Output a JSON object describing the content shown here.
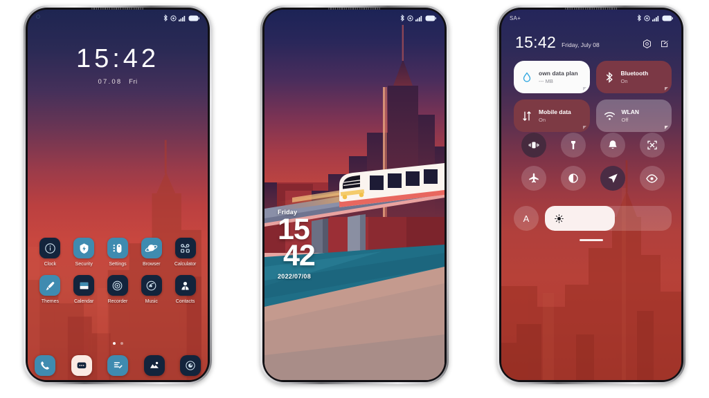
{
  "scene": {
    "background": "#ffffff",
    "phone_count": 3
  },
  "phone1": {
    "name": "home-screen",
    "statusbar": {
      "left_text": "",
      "icons": [
        "bluetooth-icon",
        "alarm-icon",
        "signal-icon",
        "battery-icon"
      ]
    },
    "clock": {
      "time": "15:42",
      "date": "07.08",
      "weekday": "Fri"
    },
    "apps": [
      {
        "label": "Clock",
        "icon": "clock-icon",
        "bg": "#13243c",
        "fg": "#cfe2ef"
      },
      {
        "label": "Security",
        "icon": "shield-icon",
        "bg": "#3f8bb0",
        "fg": "#ffffff"
      },
      {
        "label": "Settings",
        "icon": "settings-icon",
        "bg": "#3f8bb0",
        "fg": "#ffffff"
      },
      {
        "label": "Browser",
        "icon": "browser-icon",
        "bg": "#3f8bb0",
        "fg": "#ffffff"
      },
      {
        "label": "Calculator",
        "icon": "calculator-icon",
        "bg": "#13243c",
        "fg": "#cfe2ef"
      },
      {
        "label": "Themes",
        "icon": "themes-icon",
        "bg": "#3f8bb0",
        "fg": "#ffffff"
      },
      {
        "label": "Calendar",
        "icon": "calendar-icon",
        "bg": "#13243c",
        "fg": "#cfe2ef"
      },
      {
        "label": "Recorder",
        "icon": "recorder-icon",
        "bg": "#13243c",
        "fg": "#cfe2ef"
      },
      {
        "label": "Music",
        "icon": "music-icon",
        "bg": "#13243c",
        "fg": "#cfe2ef"
      },
      {
        "label": "Contacts",
        "icon": "contacts-icon",
        "bg": "#13243c",
        "fg": "#cfe2ef"
      }
    ],
    "page_dots": {
      "count": 2,
      "active_index": 0
    },
    "dock": [
      {
        "label": "Phone",
        "icon": "phone-icon",
        "bg": "#3f8bb0",
        "fg": "#ffffff"
      },
      {
        "label": "Messages",
        "icon": "message-icon",
        "bg": "#fbeae3",
        "fg": "#13243c"
      },
      {
        "label": "Notes",
        "icon": "notes-icon",
        "bg": "#3f8bb0",
        "fg": "#ffffff"
      },
      {
        "label": "Gallery",
        "icon": "gallery-icon",
        "bg": "#13243c",
        "fg": "#ffffff"
      },
      {
        "label": "Camera",
        "icon": "camera-icon",
        "bg": "#13243c",
        "fg": "#cfe2ef"
      }
    ]
  },
  "phone2": {
    "name": "lock-screen",
    "statusbar": {
      "left_text": "",
      "icons": [
        "bluetooth-icon",
        "alarm-icon",
        "signal-icon",
        "battery-icon"
      ]
    },
    "lock": {
      "weekday": "Friday",
      "hour": "15",
      "minute": "42",
      "date": "2022/07/08"
    },
    "wallpaper": {
      "name": "city-train-wallpaper",
      "subject": "elevated train at dusk over river"
    }
  },
  "phone3": {
    "name": "notification-shade",
    "statusbar": {
      "left_text": "SA+",
      "icons": [
        "bluetooth-icon",
        "alarm-icon",
        "signal-icon",
        "battery-icon"
      ]
    },
    "header": {
      "time": "15:42",
      "date": "Friday, July 08",
      "actions": [
        "settings-icon",
        "edit-icon"
      ]
    },
    "big_tiles": [
      {
        "title": "own data plan",
        "subtitle": "--- MB",
        "icon": "data-drop-icon",
        "state": "active"
      },
      {
        "title": "Bluetooth",
        "subtitle": "On",
        "icon": "bluetooth-icon",
        "state": "on"
      },
      {
        "title": "Mobile data",
        "subtitle": "On",
        "icon": "mobile-data-icon",
        "state": "on"
      },
      {
        "title": "WLAN",
        "subtitle": "Off",
        "icon": "wifi-icon",
        "state": "off"
      }
    ],
    "round_toggles": [
      {
        "name": "vibrate-icon",
        "state": "on"
      },
      {
        "name": "flashlight-icon",
        "state": "off"
      },
      {
        "name": "bell-icon",
        "state": "off"
      },
      {
        "name": "screenshot-icon",
        "state": "off"
      },
      {
        "name": "airplane-icon",
        "state": "off"
      },
      {
        "name": "dark-mode-icon",
        "state": "off"
      },
      {
        "name": "location-icon",
        "state": "on"
      },
      {
        "name": "eye-comfort-icon",
        "state": "off"
      }
    ],
    "brightness": {
      "auto_label": "A",
      "icon": "brightness-icon",
      "value_percent": 55
    }
  },
  "colors": {
    "accent_blue": "#3f8bb0",
    "dark_navy": "#13243c",
    "wallpaper_red": "#b94437",
    "wallpaper_navy": "#1e2551",
    "tile_on": "#7e3a46",
    "tile_off": "#b08890"
  }
}
